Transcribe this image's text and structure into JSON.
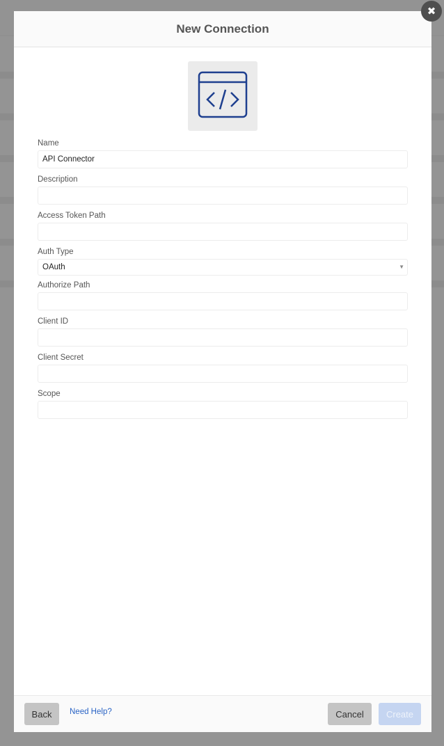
{
  "dialog": {
    "title": "New Connection",
    "close_icon": "close-icon",
    "hero_icon": "code-window-icon",
    "accent_color": "#1e3f8f"
  },
  "form": {
    "fields": [
      {
        "label": "Name",
        "value": "API Connector",
        "placeholder": ""
      },
      {
        "label": "Description",
        "value": "",
        "placeholder": ""
      },
      {
        "label": "Access Token Path",
        "value": "",
        "placeholder": ""
      },
      {
        "label": "Auth Type",
        "type": "select",
        "value": "OAuth"
      },
      {
        "label": "Authorize Path",
        "value": "",
        "placeholder": ""
      },
      {
        "label": "Client ID",
        "value": "",
        "placeholder": ""
      },
      {
        "label": "Client Secret",
        "value": "",
        "placeholder": ""
      },
      {
        "label": "Scope",
        "value": "",
        "placeholder": ""
      }
    ]
  },
  "footer": {
    "back_label": "Back",
    "help_label": "Need Help?",
    "cancel_label": "Cancel",
    "create_label": "Create"
  }
}
